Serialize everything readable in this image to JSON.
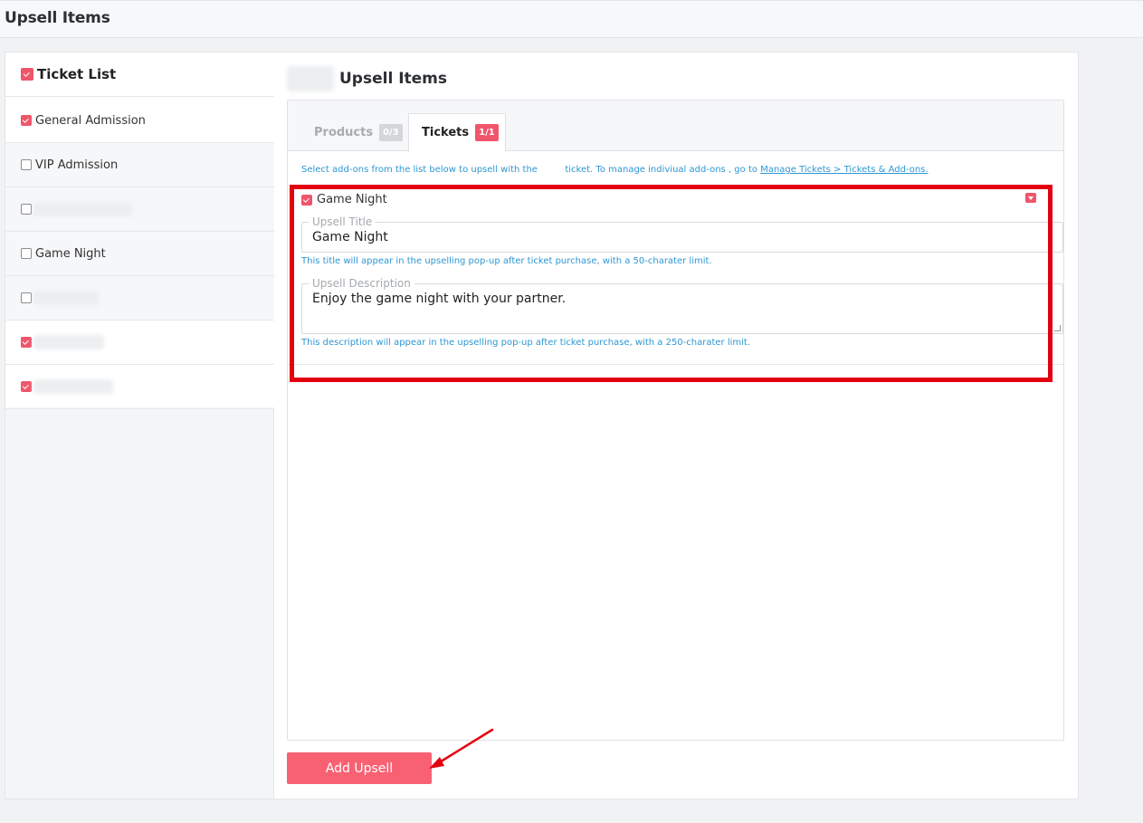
{
  "header": {
    "title": "Upsell Items"
  },
  "sidebar": {
    "items": [
      {
        "label": "Ticket List",
        "checked": true
      },
      {
        "label": "General Admission",
        "checked": true
      },
      {
        "label": "VIP Admission",
        "checked": false
      },
      {
        "label": "",
        "checked": false
      },
      {
        "label": "Game Night",
        "checked": false
      },
      {
        "label": "",
        "checked": false
      },
      {
        "label": "",
        "checked": true
      },
      {
        "label": "",
        "checked": true
      }
    ]
  },
  "panel": {
    "title": "Upsell Items",
    "tabs": [
      {
        "label": "Products",
        "badge": "0/3",
        "active": false
      },
      {
        "label": "Tickets",
        "badge": "1/1",
        "active": true
      }
    ],
    "hint_prefix": "Select add-ons from the list below to upsell with the",
    "hint_middle": "ticket. To manage indiviual add-ons , go to",
    "hint_link": "Manage Tickets > Tickets & Add-ons.",
    "addon": {
      "name": "Game Night",
      "checked": true,
      "upsell_title_legend": "Upsell Title",
      "upsell_title_value": "Game Night",
      "upsell_title_help": "This title will appear in the upselling pop-up after ticket purchase, with a 50-charater limit.",
      "upsell_desc_legend": "Upsell Description",
      "upsell_desc_value": "Enjoy the game night with your partner.",
      "upsell_desc_help": "This description will appear in the upselling pop-up after ticket purchase, with a 250-charater limit."
    },
    "add_button": "Add Upsell"
  },
  "colors": {
    "accent": "#f0566b",
    "button": "#f86172",
    "link": "#2d97d3",
    "highlight": "#e3000f"
  }
}
